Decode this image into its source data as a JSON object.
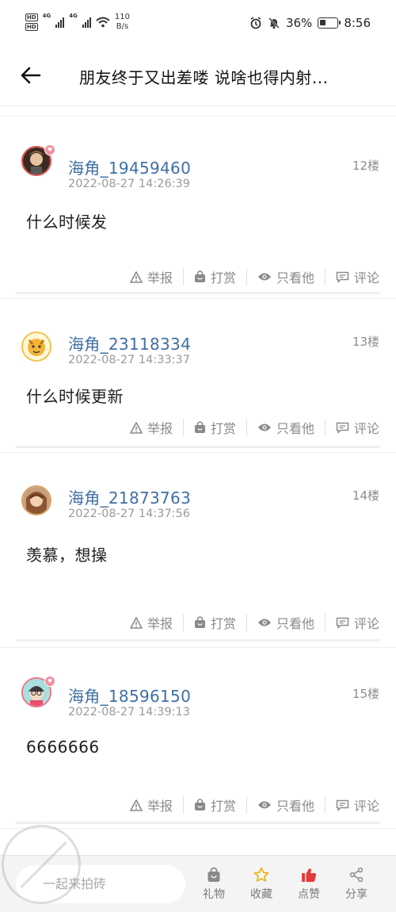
{
  "status_bar": {
    "net1": "4G",
    "net2": "4G",
    "speed_value": "110",
    "speed_unit": "B/s",
    "battery": "36%",
    "battery_level": 0.36,
    "time": "8:56"
  },
  "header": {
    "title": "朋友终于又出差喽  说啥也得内射..."
  },
  "posts": [
    {
      "username": "海角_19459460",
      "timestamp": "2022-08-27 14:26:39",
      "floor": "12楼",
      "content": "什么时候发"
    },
    {
      "username": "海角_23118334",
      "timestamp": "2022-08-27 14:33:37",
      "floor": "13楼",
      "content": "什么时候更新"
    },
    {
      "username": "海角_21873763",
      "timestamp": "2022-08-27 14:37:56",
      "floor": "14楼",
      "content": "羡慕，想操"
    },
    {
      "username": "海角_18596150",
      "timestamp": "2022-08-27 14:39:13",
      "floor": "15楼",
      "content": "6666666"
    }
  ],
  "actions": {
    "report": "举报",
    "tip": "打赏",
    "only_him": "只看他",
    "comment": "评论"
  },
  "bottom_bar": {
    "input_placeholder": "一起来拍砖",
    "gift": "礼物",
    "favorite": "收藏",
    "like": "点赞",
    "share": "分享"
  },
  "colors": {
    "username": "#3f6fa4",
    "like_red": "#e23a3a",
    "favorite_yellow": "#e9b200"
  }
}
